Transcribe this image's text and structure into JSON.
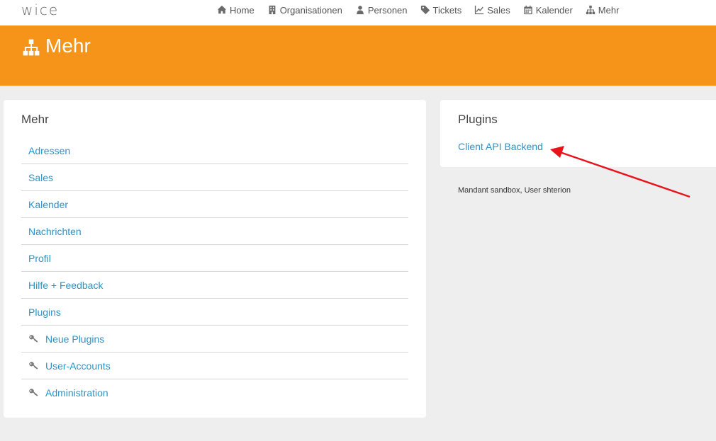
{
  "header": {
    "logo": "wice",
    "nav": [
      {
        "label": "Home",
        "icon": "home-icon"
      },
      {
        "label": "Organisationen",
        "icon": "building-icon"
      },
      {
        "label": "Personen",
        "icon": "person-icon"
      },
      {
        "label": "Tickets",
        "icon": "tag-icon"
      },
      {
        "label": "Sales",
        "icon": "line-chart-icon"
      },
      {
        "label": "Kalender",
        "icon": "calendar-icon"
      },
      {
        "label": "Mehr",
        "icon": "sitemap-icon"
      }
    ]
  },
  "banner": {
    "title": "Mehr",
    "icon": "sitemap-icon",
    "color": "#f59419"
  },
  "left_card": {
    "title": "Mehr",
    "items": [
      {
        "label": "Adressen"
      },
      {
        "label": "Sales"
      },
      {
        "label": "Kalender"
      },
      {
        "label": "Nachrichten"
      },
      {
        "label": "Profil"
      },
      {
        "label": "Hilfe + Feedback"
      },
      {
        "label": "Plugins"
      },
      {
        "label": "Neue Plugins",
        "icon": "key-icon"
      },
      {
        "label": "User-Accounts",
        "icon": "key-icon"
      },
      {
        "label": "Administration",
        "icon": "key-icon"
      }
    ]
  },
  "right_card": {
    "title": "Plugins",
    "link": "Client API Backend"
  },
  "footer": {
    "text": "Mandant sandbox, User shterion"
  },
  "colors": {
    "link": "#2a93c9",
    "annotation_arrow": "#e8141b"
  }
}
